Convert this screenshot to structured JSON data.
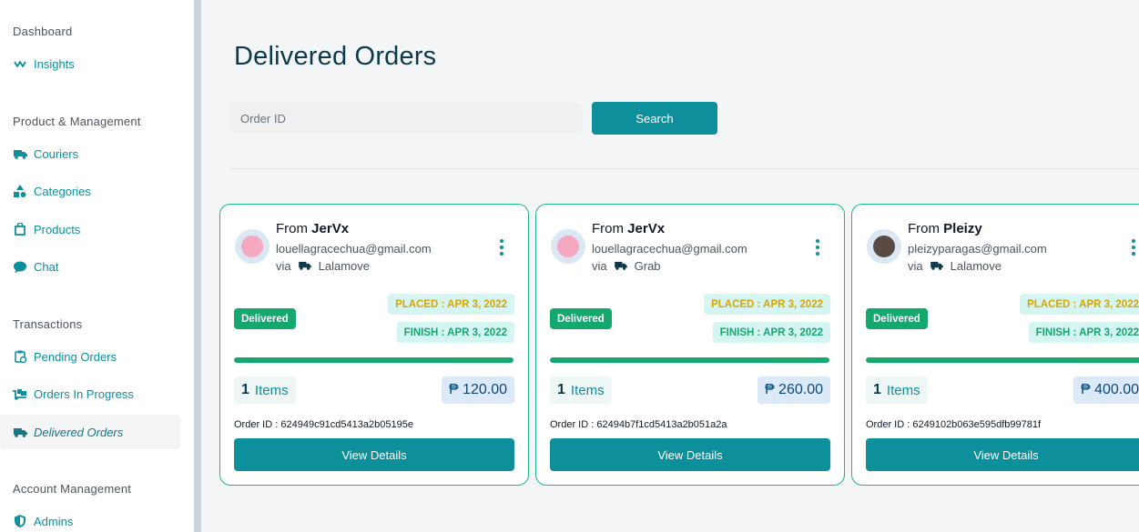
{
  "sidebar": {
    "sections": [
      {
        "title": "Dashboard",
        "items": [
          {
            "label": "Insights",
            "icon": "activity-icon"
          }
        ]
      },
      {
        "title": "Product & Management",
        "items": [
          {
            "label": "Couriers",
            "icon": "truck-icon"
          },
          {
            "label": "Categories",
            "icon": "shapes-icon"
          },
          {
            "label": "Products",
            "icon": "shopping-bag-icon"
          },
          {
            "label": "Chat",
            "icon": "chat-bubble-icon"
          }
        ]
      },
      {
        "title": "Transactions",
        "items": [
          {
            "label": "Pending Orders",
            "icon": "clipboard-clock-icon"
          },
          {
            "label": "Orders In Progress",
            "icon": "hand-truck-icon"
          },
          {
            "label": "Delivered Orders",
            "icon": "truck-icon",
            "active": true
          }
        ]
      },
      {
        "title": "Account Management",
        "items": [
          {
            "label": "Admins",
            "icon": "shield-icon"
          }
        ]
      }
    ]
  },
  "main": {
    "title": "Delivered Orders",
    "search": {
      "placeholder": "Order ID",
      "value": "",
      "button_label": "Search"
    }
  },
  "orders": [
    {
      "from_prefix": "From",
      "name": "JerVx",
      "email": "louellagracechua@gmail.com",
      "via_prefix": "via",
      "courier": "Lalamove",
      "status": "Delivered",
      "placed": "PLACED : APR 3, 2022",
      "finish": "FINISH : APR 3, 2022",
      "progress": 1.0,
      "items_count": "1",
      "items_label": "Items",
      "price": "₱ 120.00",
      "order_id_label": "Order ID :",
      "order_id": "624949c91cd5413a2b05195e",
      "details_label": "View Details",
      "avatar_color": "#f4a9c0"
    },
    {
      "from_prefix": "From",
      "name": "JerVx",
      "email": "louellagracechua@gmail.com",
      "via_prefix": "via",
      "courier": "Grab",
      "status": "Delivered",
      "placed": "PLACED : APR 3, 2022",
      "finish": "FINISH : APR 3, 2022",
      "progress": 1.0,
      "items_count": "1",
      "items_label": "Items",
      "price": "₱ 260.00",
      "order_id_label": "Order ID :",
      "order_id": "62494b7f1cd5413a2b051a2a",
      "details_label": "View Details",
      "avatar_color": "#f4a9c0"
    },
    {
      "from_prefix": "From",
      "name": "Pleizy",
      "email": "pleizyparagas@gmail.com",
      "via_prefix": "via",
      "courier": "Lalamove",
      "status": "Delivered",
      "placed": "PLACED : APR 3, 2022",
      "finish": "FINISH : APR 3, 2022",
      "progress": 1.0,
      "items_count": "1",
      "items_label": "Items",
      "price": "₱ 400.00",
      "order_id_label": "Order ID :",
      "order_id": "6249102b063e595dfb99781f",
      "details_label": "View Details",
      "avatar_color": "#5a4a44"
    }
  ],
  "colors": {
    "accent": "#0e8f9c",
    "success": "#14a86e",
    "warning": "#d9a400",
    "card_border": "#18b887"
  }
}
